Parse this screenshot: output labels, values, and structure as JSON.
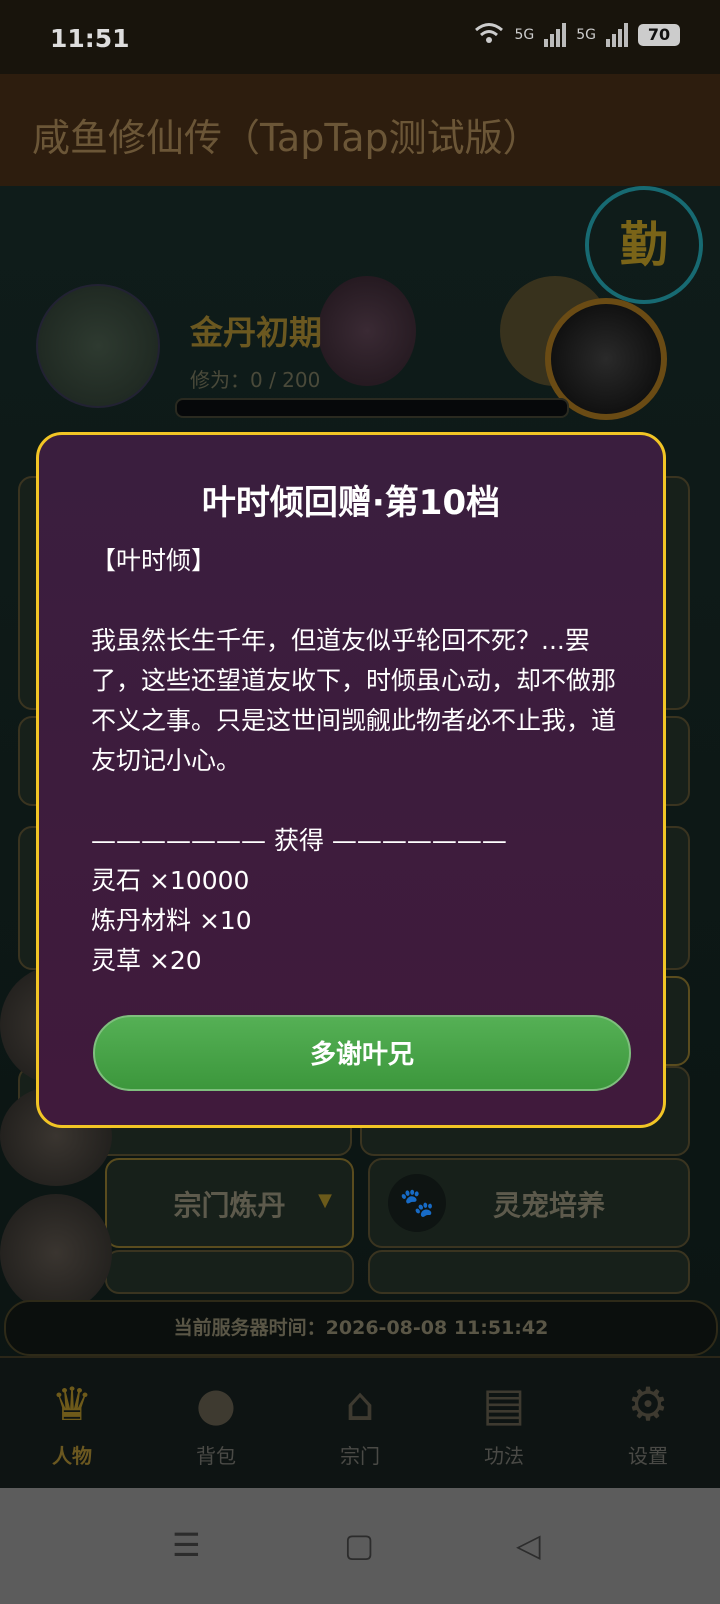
{
  "status_bar": {
    "time": "11:51",
    "net1": "5G",
    "net2": "5G",
    "battery": "70"
  },
  "app_bar": {
    "title": "咸鱼修仙传（TapTap测试版）"
  },
  "game": {
    "diligence_badge": "勤",
    "realm": "金丹初期",
    "cultivation": "修为：0 / 200",
    "button_sect_alchemy": "宗门炼丹",
    "button_pet_training": "灵宠培养",
    "server_time_label": "当前服务器时间：",
    "server_time_value": "2026-08-08 11:51:42"
  },
  "tabs": [
    {
      "label": "人物",
      "icon": "character-icon"
    },
    {
      "label": "背包",
      "icon": "bag-icon"
    },
    {
      "label": "宗门",
      "icon": "sect-icon"
    },
    {
      "label": "功法",
      "icon": "scroll-icon"
    },
    {
      "label": "设置",
      "icon": "gear-icon"
    }
  ],
  "dialog": {
    "title": "叶时倾回赠·第10档",
    "speaker": "【叶时倾】",
    "message": "我虽然长生千年，但道友似乎轮回不死？...罢了，这些还望道友收下，时倾虽心动，却不做那不义之事。只是这世间觊觎此物者必不止我，道友切记小心。",
    "divider": "——————— 获得 ———————",
    "rewards": [
      "灵石 ×10000",
      "炼丹材料 ×10",
      "灵草 ×20"
    ],
    "confirm_label": "多谢叶兄"
  },
  "colors": {
    "dialog_border": "#f2c525",
    "dialog_bg": "#3c1c3e",
    "confirm_button": "#4caf50"
  }
}
